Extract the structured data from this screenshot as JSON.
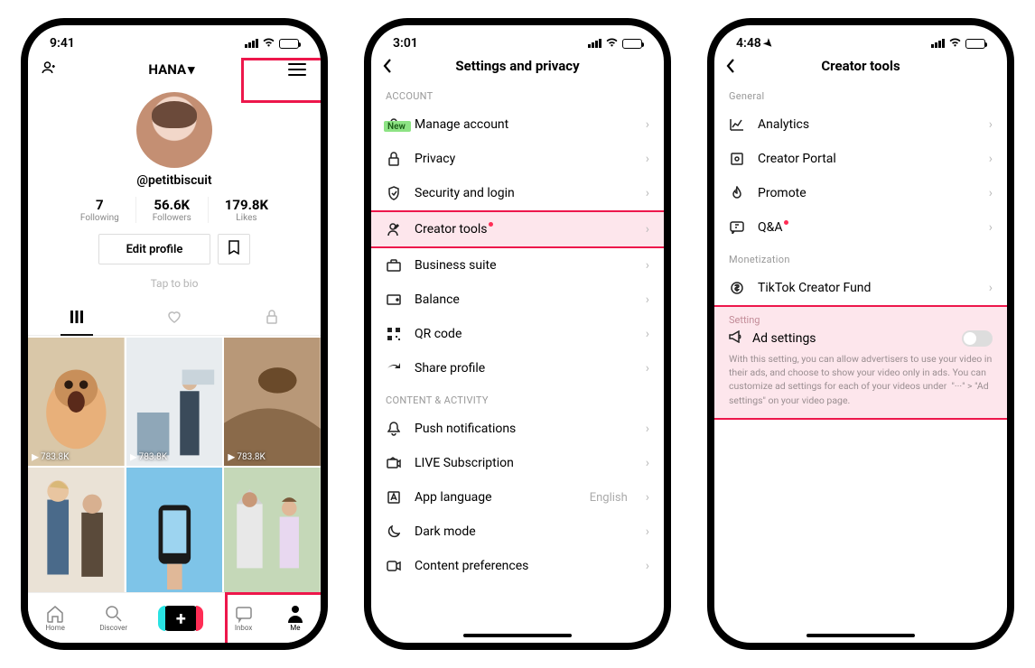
{
  "phone1": {
    "status_time": "9:41",
    "profile_name": "HANA",
    "handle": "@petitbiscuit",
    "stats": [
      {
        "num": "7",
        "label": "Following"
      },
      {
        "num": "56.6K",
        "label": "Followers"
      },
      {
        "num": "179.8K",
        "label": "Likes"
      }
    ],
    "edit_label": "Edit profile",
    "tap_bio": "Tap to bio",
    "thumb_views": "783.8K",
    "tabbar": {
      "home": "Home",
      "discover": "Discover",
      "inbox": "Inbox",
      "me": "Me"
    }
  },
  "phone2": {
    "status_time": "3:01",
    "title": "Settings and privacy",
    "new_badge": "New",
    "sections": {
      "account": "ACCOUNT",
      "content": "CONTENT & ACTIVITY"
    },
    "rows": {
      "manage": "Manage account",
      "privacy": "Privacy",
      "security": "Security and login",
      "creator": "Creator tools",
      "business": "Business suite",
      "balance": "Balance",
      "qr": "QR code",
      "share": "Share profile",
      "push": "Push notifications",
      "live": "LIVE Subscription",
      "lang": "App language",
      "lang_value": "English",
      "dark": "Dark mode",
      "content_prefs": "Content preferences"
    }
  },
  "phone3": {
    "status_time": "4:48",
    "title": "Creator tools",
    "sections": {
      "general": "General",
      "monetization": "Monetization",
      "setting": "Setting"
    },
    "rows": {
      "analytics": "Analytics",
      "portal": "Creator Portal",
      "promote": "Promote",
      "qa": "Q&A",
      "fund": "TikTok Creator Fund",
      "ad": "Ad settings"
    },
    "ad_desc": "With this setting, you can allow advertisers to use your video in their ads, and choose to show your video only in ads. You can customize ad settings for each of your videos under  \"···\" > \"Ad settings\" on your video page."
  }
}
